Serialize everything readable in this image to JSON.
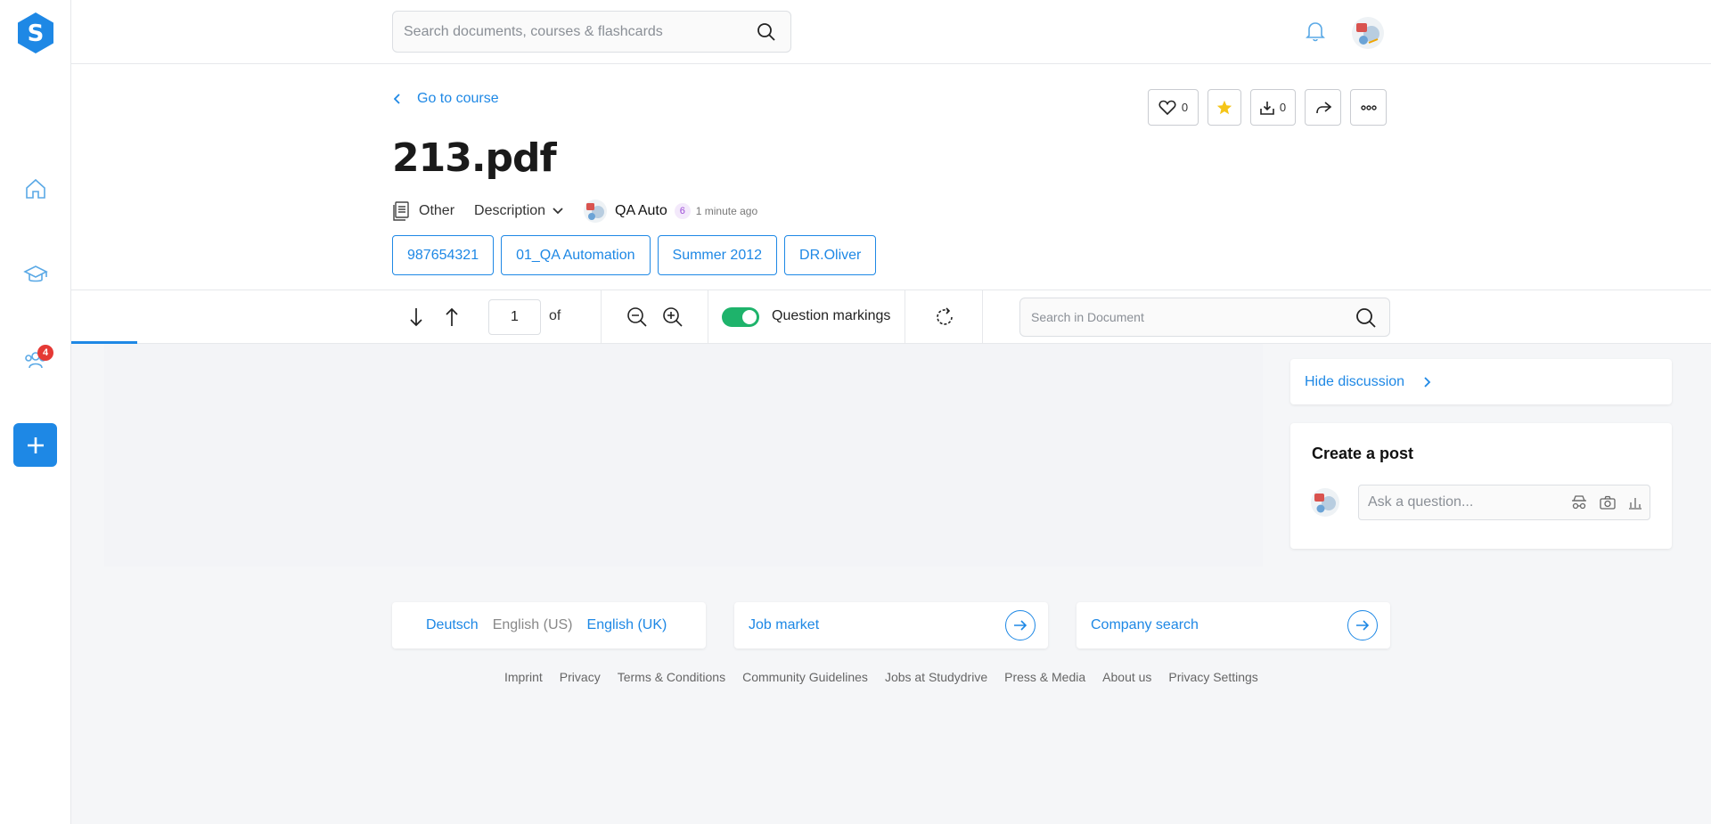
{
  "brand": {
    "logo_letter": "S",
    "accent": "#1e88e5"
  },
  "topbar": {
    "search_placeholder": "Search documents, courses & flashcards"
  },
  "rail": {
    "notification_count": "4"
  },
  "document": {
    "back_label": "Go to course",
    "title": "213.pdf",
    "type": "Other",
    "description_label": "Description",
    "author": "QA Auto",
    "author_level": "6",
    "uploaded": "1 minute ago",
    "tags": [
      "987654321",
      "01_QA Automation",
      "Summer 2012",
      "DR.Oliver"
    ]
  },
  "actions": {
    "likes": "0",
    "downloads": "0"
  },
  "toolbar": {
    "page_value": "1",
    "of_label": "of",
    "question_markings_label": "Question markings",
    "question_markings_on": true,
    "search_placeholder": "Search in Document"
  },
  "discussion": {
    "hide_label": "Hide discussion",
    "create_title": "Create a post",
    "ask_placeholder": "Ask a question..."
  },
  "footer": {
    "languages": [
      "Deutsch",
      "English (US)",
      "English (UK)"
    ],
    "job_market": "Job market",
    "company_search": "Company search",
    "links": [
      "Imprint",
      "Privacy",
      "Terms & Conditions",
      "Community Guidelines",
      "Jobs at Studydrive",
      "Press & Media",
      "About us",
      "Privacy Settings"
    ]
  }
}
